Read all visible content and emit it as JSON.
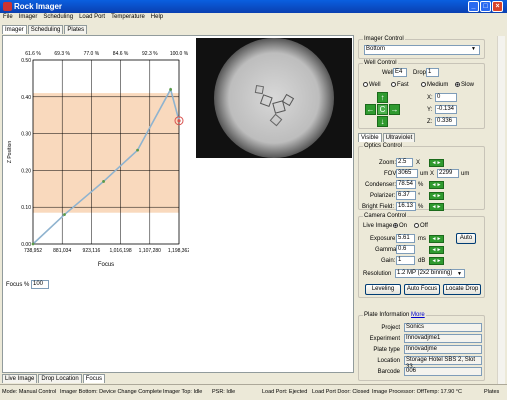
{
  "window": {
    "title": "Rock Imager"
  },
  "menu": [
    "File",
    "Imager",
    "Scheduling",
    "Load Port",
    "Temperature",
    "Help"
  ],
  "main_tabs": [
    "Imager",
    "Scheduling",
    "Plates"
  ],
  "bottom_tabs": [
    "Live Image",
    "Drop Location",
    "Focus"
  ],
  "chart_data": {
    "type": "line",
    "title": "",
    "xlabel": "Focus",
    "ylabel": "Z Position",
    "x_ticks": [
      "738,952",
      "881,034",
      "923,116",
      "1,016,198",
      "1,107,280",
      "1,198,362"
    ],
    "y_ticks": [
      "0.00",
      "0.10",
      "0.20",
      "0.30",
      "0.40",
      "0.50"
    ],
    "top_ticks": [
      "61.6 %",
      "69.3 %",
      "77.0 %",
      "84.6 %",
      "92.3 %",
      "100.0 %"
    ],
    "xlim": [
      738952,
      1198362
    ],
    "ylim": [
      0,
      0.5
    ],
    "band": [
      0.085,
      0.41
    ],
    "x": [
      738952,
      838000,
      961000,
      1068000,
      1172000,
      1198362
    ],
    "y": [
      0.0,
      0.08,
      0.17,
      0.255,
      0.42,
      0.335
    ],
    "highlight": {
      "x": 1198362,
      "y": 0.335
    }
  },
  "focus": {
    "label": "Focus %",
    "value": "100"
  },
  "imager_control": {
    "legend": "Imager Control",
    "select": "Bottom"
  },
  "well_control": {
    "legend": "Well Control",
    "well_label": "Well",
    "well": "E4",
    "drop_label": "Drop",
    "drop": "1",
    "speeds": [
      "Well",
      "Fast",
      "Medium",
      "Slow"
    ],
    "x_label": "X:",
    "x": "0",
    "y_label": "Y:",
    "y": "-0.134",
    "z_label": "Z:",
    "z": "0.336",
    "center": "C"
  },
  "vis_tabs": [
    "Visible",
    "Ultraviolet"
  ],
  "optics": {
    "legend": "Optics Control",
    "zoom_label": "Zoom:",
    "zoom": "2.5",
    "zoom_unit": "X",
    "fov_label": "FOV:",
    "fov_w": "3065",
    "fov_w_unit": "um",
    "fov_x": "X",
    "fov_h": "2299",
    "fov_h_unit": "um",
    "condenser_label": "Condenser:",
    "condenser": "78.54",
    "condenser_unit": "%",
    "polarizer_label": "Polarizer:",
    "polarizer": "6.37",
    "polarizer_unit": "°",
    "brightfield_label": "Bright Field:",
    "brightfield": "16.13",
    "brightfield_unit": "%"
  },
  "camera": {
    "legend": "Camera Control",
    "live_label": "Live Image",
    "on": "On",
    "off": "Off",
    "exposure_label": "Exposure:",
    "exposure": "5.61",
    "exposure_unit": "ms",
    "auto": "Auto",
    "gamma_label": "Gamma:",
    "gamma": "0.6",
    "gain_label": "Gain:",
    "gain": "1",
    "gain_unit": "dB",
    "resolution_label": "Resolution",
    "resolution": "1.2 MP (2x2 binning)",
    "leveling": "Leveling",
    "autofocus": "Auto Focus",
    "locate": "Locate Drop"
  },
  "plate_info": {
    "legend": "Plate Information",
    "more": "More",
    "rows": [
      {
        "k": "Project",
        "v": "Sonics"
      },
      {
        "k": "Experiment",
        "v": "Innovadjme1"
      },
      {
        "k": "Plate type",
        "v": "Innovadjme"
      },
      {
        "k": "Location",
        "v": "Storage Hotel SBS 2, Slot 33"
      },
      {
        "k": "Barcode",
        "v": "006"
      }
    ]
  },
  "status": [
    "Mode: Manual Control",
    "Imager Bottom: Device Change Complete",
    "Imager Top: Idle",
    "PSR: Idle",
    "Load Port: Ejected",
    "Load Port Door: Closed",
    "Image Processor: Off",
    "Temp: 17.90 °C",
    "Plates"
  ],
  "colors": {
    "band": "#f9d9bd",
    "line": "#8fb3cf",
    "marker": "#5a9a48",
    "highlight": "#d9534f"
  }
}
